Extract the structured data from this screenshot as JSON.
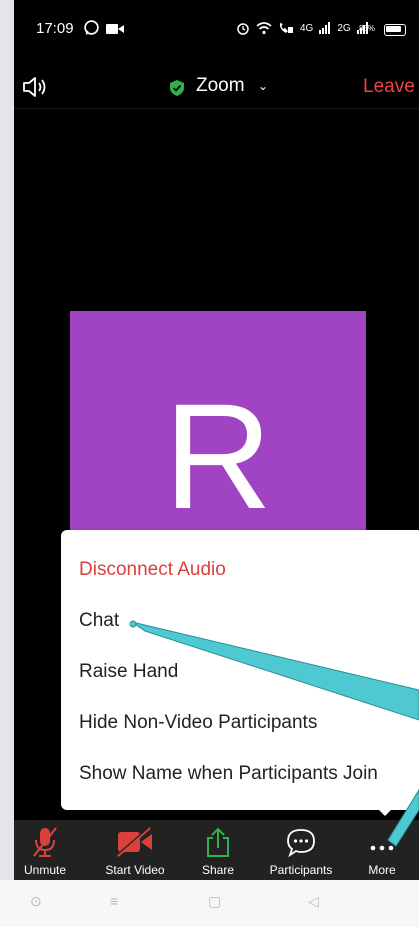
{
  "status_bar": {
    "time": "17:09",
    "network_left": "4G",
    "network_right": "2G",
    "battery_pct": "83%"
  },
  "meeting": {
    "title": "Zoom",
    "leave_label": "Leave",
    "participant_initial": "R"
  },
  "menu": {
    "items": [
      {
        "label": "Disconnect Audio"
      },
      {
        "label": "Chat"
      },
      {
        "label": "Raise Hand"
      },
      {
        "label": "Hide Non-Video Participants"
      },
      {
        "label": "Show Name when Participants Join"
      }
    ]
  },
  "toolbar": {
    "buttons": [
      {
        "label": "Unmute",
        "icon": "mic-muted-icon"
      },
      {
        "label": "Start Video",
        "icon": "video-off-icon"
      },
      {
        "label": "Share",
        "icon": "share-icon"
      },
      {
        "label": "Participants",
        "icon": "participants-icon"
      },
      {
        "label": "More",
        "icon": "more-icon"
      }
    ]
  },
  "colors": {
    "leave": "#e44444",
    "disconnect": "#d9413a",
    "avatar_bg": "#a144c3",
    "share_icon": "#2fb24c",
    "annotation_arrow": "#4ec9d2"
  }
}
